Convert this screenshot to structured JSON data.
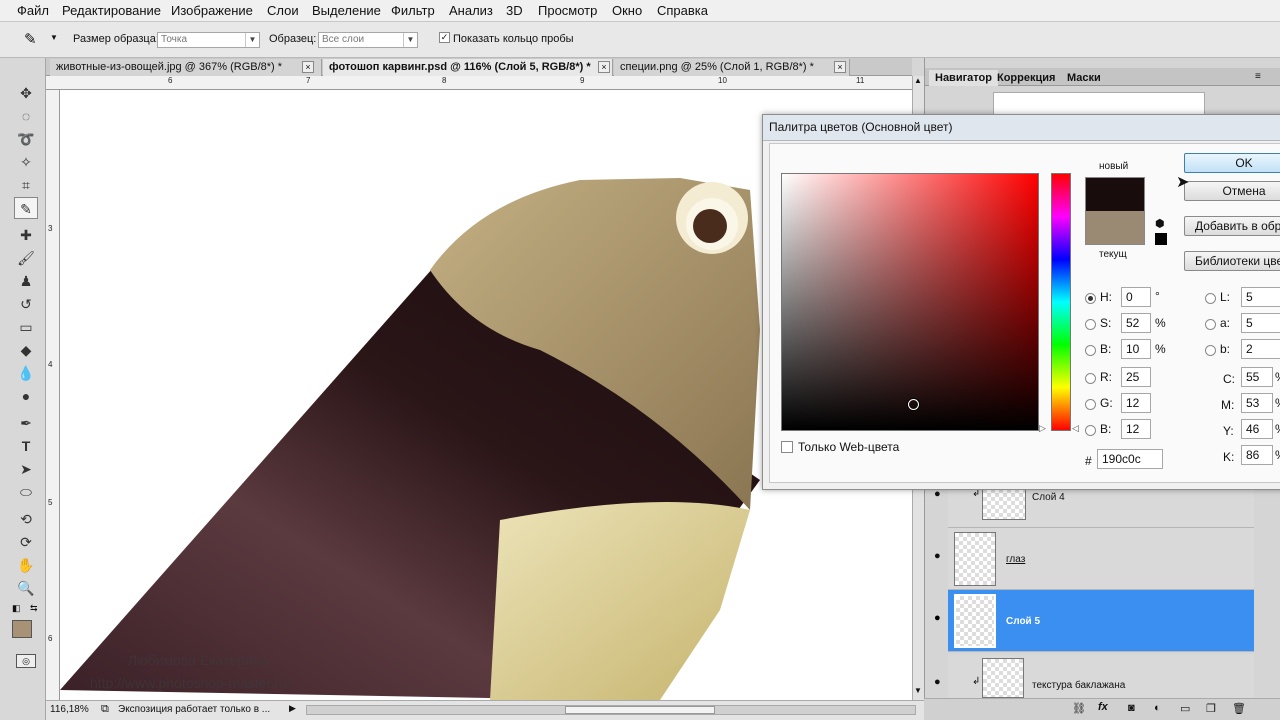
{
  "menu": [
    "Файл",
    "Редактирование",
    "Изображение",
    "Слои",
    "Выделение",
    "Фильтр",
    "Анализ",
    "3D",
    "Просмотр",
    "Окно",
    "Справка"
  ],
  "options": {
    "sample_size_label": "Размер образца:",
    "sample_size_value": "Точка",
    "sample_label": "Образец:",
    "sample_value": "Все слои",
    "show_ring_label": "Показать кольцо пробы"
  },
  "tabs": [
    {
      "label": "животные-из-овощей.jpg @ 367% (RGB/8*) *"
    },
    {
      "label": "фотошоп карвинг.psd @ 116% (Слой 5, RGB/8*) *"
    },
    {
      "label": "специи.png @ 25% (Слой 1, RGB/8*) *"
    }
  ],
  "ruler": {
    "top": [
      "6",
      "7",
      "8",
      "9",
      "10",
      "11"
    ],
    "left": [
      "3",
      "4",
      "5",
      "6"
    ]
  },
  "watermark": {
    "line1": "Любимова Екатерина",
    "line2": "http://www.photoshop-master.ru/"
  },
  "status": {
    "zoom": "116,18%",
    "message": "Экспозиция работает только в ..."
  },
  "panel": {
    "tabs": [
      "Навигатор",
      "Коррекция",
      "Маски"
    ],
    "layers": [
      {
        "name": "Слой 4",
        "selected": false
      },
      {
        "name": "глаз",
        "selected": false
      },
      {
        "name": "Слой 5",
        "selected": true
      },
      {
        "name": "текстура баклажана",
        "selected": false
      }
    ]
  },
  "dialog": {
    "title": "Палитра цветов (Основной цвет)",
    "new_label": "новый",
    "current_label": "текущ",
    "new_color": "#190c0c",
    "current_color": "#9a8a73",
    "buttons": {
      "ok": "OK",
      "cancel": "Отмена",
      "add_swatch": "Добавить в образцы",
      "libraries": "Библиотеки цветов"
    },
    "web_only_label": "Только Web-цвета",
    "hsb": [
      {
        "label": "H:",
        "value": "0",
        "unit": "°",
        "on": true
      },
      {
        "label": "S:",
        "value": "52",
        "unit": "%",
        "on": false
      },
      {
        "label": "B:",
        "value": "10",
        "unit": "%",
        "on": false
      }
    ],
    "rgb": [
      {
        "label": "R:",
        "value": "25"
      },
      {
        "label": "G:",
        "value": "12"
      },
      {
        "label": "B:",
        "value": "12"
      }
    ],
    "lab": [
      {
        "label": "L:",
        "value": "5"
      },
      {
        "label": "a:",
        "value": "5"
      },
      {
        "label": "b:",
        "value": "2"
      }
    ],
    "cmyk": [
      {
        "label": "C:",
        "value": "55",
        "unit": "%"
      },
      {
        "label": "M:",
        "value": "53",
        "unit": "%"
      },
      {
        "label": "Y:",
        "value": "46",
        "unit": "%"
      },
      {
        "label": "K:",
        "value": "86",
        "unit": "%"
      }
    ],
    "hex_label": "#",
    "hex": "190c0c"
  },
  "colors": {
    "foreground": "#a89275",
    "selection": "#3b8ff0",
    "hue_base": "#ff0000"
  }
}
